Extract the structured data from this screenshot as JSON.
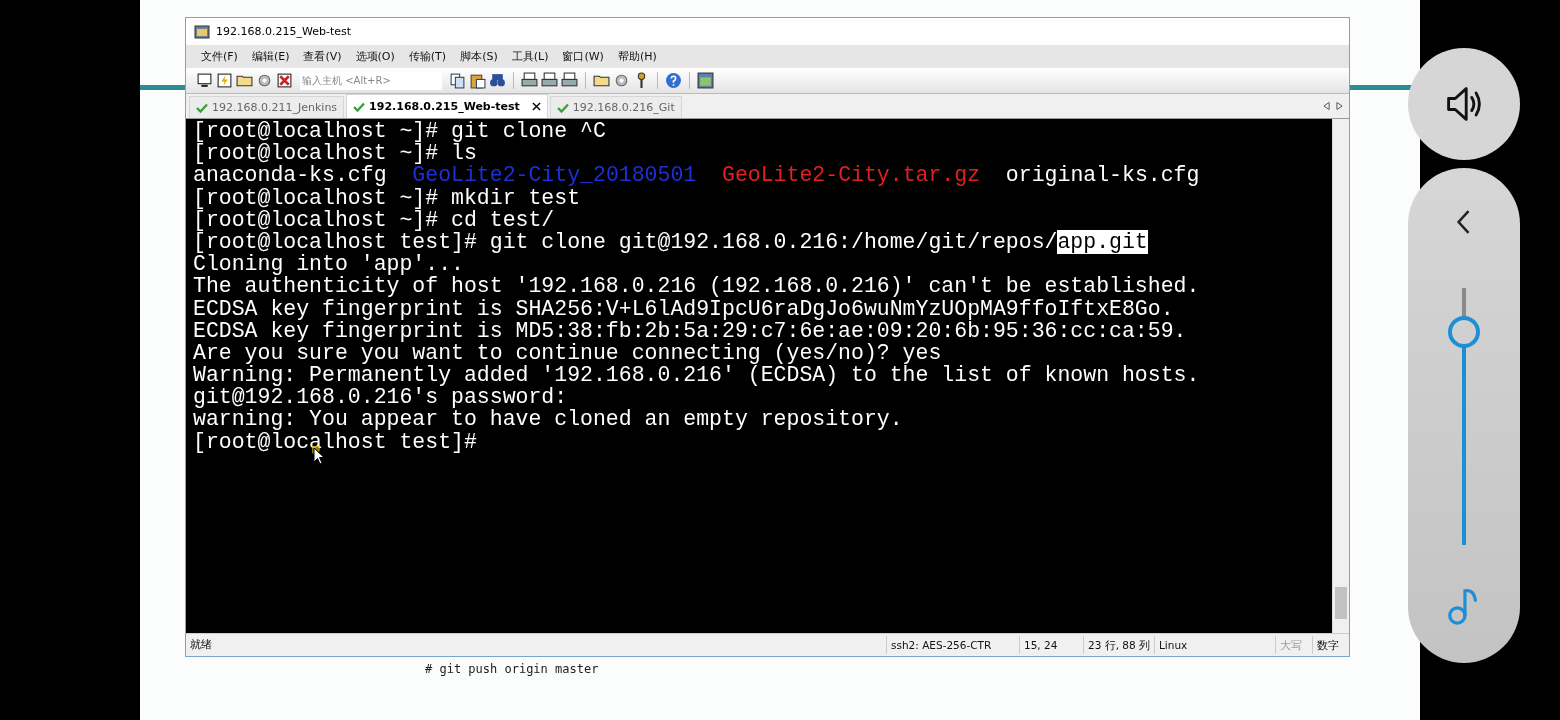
{
  "window": {
    "title": "192.168.0.215_Web-test"
  },
  "menu": [
    "文件(F)",
    "编辑(E)",
    "查看(V)",
    "选项(O)",
    "传输(T)",
    "脚本(S)",
    "工具(L)",
    "窗口(W)",
    "帮助(H)"
  ],
  "toolbar": {
    "host_placeholder": "输入主机 <Alt+R>"
  },
  "tabs": [
    {
      "label": "192.168.0.211_Jenkins",
      "selected": false
    },
    {
      "label": "192.168.0.215_Web-test",
      "selected": true
    },
    {
      "label": "192.168.0.216_Git",
      "selected": false
    }
  ],
  "terminal": {
    "lines": [
      [
        {
          "text": "[root@localhost ~]# git clone ^C",
          "kind": "plain"
        }
      ],
      [
        {
          "text": "[root@localhost ~]# ls",
          "kind": "plain"
        }
      ],
      [
        {
          "text": "anaconda-ks.cfg  ",
          "kind": "plain"
        },
        {
          "text": "GeoLite2-City_20180501",
          "kind": "directory"
        },
        {
          "text": "  GeoLite2-City.tar.gz",
          "kind": "archive"
        },
        {
          "text": "  original-ks.cfg",
          "kind": "plain"
        }
      ],
      [
        {
          "text": "[root@localhost ~]# mkdir test",
          "kind": "plain"
        }
      ],
      [
        {
          "text": "[root@localhost ~]# cd test/",
          "kind": "plain"
        }
      ],
      [
        {
          "text": "[root@localhost test]# git clone git@192.168.0.216:/home/git/repos/",
          "kind": "plain"
        },
        {
          "text": "app.git",
          "kind": "selection"
        }
      ],
      [
        {
          "text": "Cloning into 'app'...",
          "kind": "plain"
        }
      ],
      [
        {
          "text": "The authenticity of host '192.168.0.216 (192.168.0.216)' can't be established.",
          "kind": "plain"
        }
      ],
      [
        {
          "text": "ECDSA key fingerprint is SHA256:V+L6lAd9IpcU6raDgJo6wuNmYzUOpMA9ffoIftxE8Go.",
          "kind": "plain"
        }
      ],
      [
        {
          "text": "ECDSA key fingerprint is MD5:38:fb:2b:5a:29:c7:6e:ae:09:20:6b:95:36:cc:ca:59.",
          "kind": "plain"
        }
      ],
      [
        {
          "text": "Are you sure you want to continue connecting (yes/no)? yes",
          "kind": "plain"
        }
      ],
      [
        {
          "text": "Warning: Permanently added '192.168.0.216' (ECDSA) to the list of known hosts.",
          "kind": "plain"
        }
      ],
      [
        {
          "text": "git@192.168.0.216's password:",
          "kind": "plain"
        }
      ],
      [
        {
          "text": "warning: You appear to have cloned an empty repository.",
          "kind": "plain"
        }
      ],
      [
        {
          "text": "[root@localhost test]#",
          "kind": "plain"
        }
      ]
    ]
  },
  "status_bar": {
    "state": "就绪",
    "cipher": "ssh2: AES-256-CTR",
    "position": "15, 24",
    "size": "23 行, 88 列",
    "os": "Linux",
    "indicators": [
      {
        "label": "大写",
        "on": false
      },
      {
        "label": "数字",
        "on": true
      }
    ]
  },
  "slide_text": "# git push origin master",
  "volume": {
    "level": 0.83
  }
}
